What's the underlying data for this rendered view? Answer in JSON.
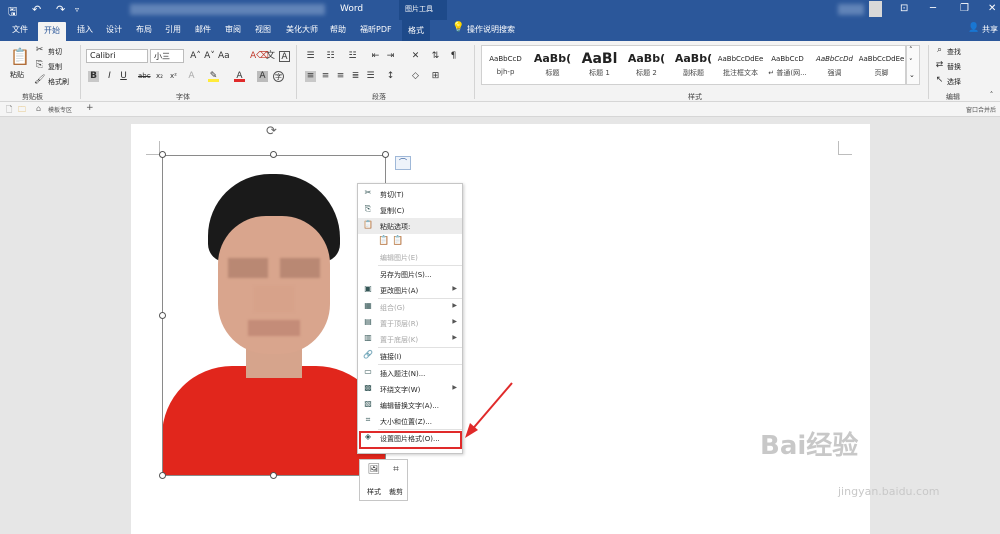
{
  "window": {
    "title": "Word",
    "context_tab_group": "图片工具"
  },
  "tabs": [
    "文件",
    "开始",
    "插入",
    "设计",
    "布局",
    "引用",
    "邮件",
    "审阅",
    "视图",
    "美化大师",
    "帮助",
    "福昕PDF",
    "格式"
  ],
  "active_tab": "开始",
  "tell_me": "操作说明搜索",
  "share_label": "共享",
  "clipboard": {
    "paste": "粘贴",
    "cut": "剪切",
    "copy": "复制",
    "format_painter": "格式刷",
    "group": "剪贴板"
  },
  "font": {
    "name": "Calibri",
    "size": "小三",
    "group": "字体",
    "bold": "B",
    "italic": "I",
    "underline": "U",
    "strike": "abc",
    "sub": "x₂",
    "sup": "x²"
  },
  "paragraph": {
    "group": "段落"
  },
  "styles": {
    "group": "样式",
    "items": [
      {
        "preview": "AaBbCcD",
        "name": "bjh-p"
      },
      {
        "preview": "AaBb(",
        "name": "标题"
      },
      {
        "preview": "AaBl",
        "name": "标题 1"
      },
      {
        "preview": "AaBb(",
        "name": "标题 2"
      },
      {
        "preview": "AaBb(",
        "name": "副标题"
      },
      {
        "preview": "AaBbCcDdEe",
        "name": "批注框文本"
      },
      {
        "preview": "AaBbCcD",
        "name": "↵ 普通(网..."
      },
      {
        "preview": "AaBbCcDd",
        "name": "强调"
      },
      {
        "preview": "AaBbCcDdEe",
        "name": "页脚"
      }
    ]
  },
  "editing": {
    "find": "查找",
    "replace": "替换",
    "select": "选择",
    "group": "编辑"
  },
  "docbar": {
    "tab": "模板专区",
    "right": "窗口合并后"
  },
  "context_menu": {
    "items": [
      {
        "icon": "✂",
        "label": "剪切(T)",
        "disabled": false
      },
      {
        "icon": "⎘",
        "label": "复制(C)",
        "disabled": false
      },
      {
        "icon": "📋",
        "label": "粘贴选项:",
        "disabled": false,
        "header": true
      },
      {
        "icon": "",
        "label": "编辑图片(E)",
        "disabled": true
      },
      {
        "icon": "",
        "label": "另存为图片(S)...",
        "disabled": false
      },
      {
        "icon": "▣",
        "label": "更改图片(A)",
        "disabled": false,
        "submenu": true
      },
      {
        "icon": "▦",
        "label": "组合(G)",
        "disabled": true,
        "submenu": true
      },
      {
        "icon": "▤",
        "label": "置于顶层(R)",
        "disabled": true,
        "submenu": true
      },
      {
        "icon": "▥",
        "label": "置于底层(K)",
        "disabled": true,
        "submenu": true
      },
      {
        "icon": "🔗",
        "label": "链接(I)",
        "disabled": false
      },
      {
        "icon": "▭",
        "label": "插入题注(N)...",
        "disabled": false
      },
      {
        "icon": "▩",
        "label": "环绕文字(W)",
        "disabled": false,
        "submenu": true
      },
      {
        "icon": "▧",
        "label": "编辑替换文字(A)...",
        "disabled": false
      },
      {
        "icon": "⌗",
        "label": "大小和位置(Z)...",
        "disabled": false
      },
      {
        "icon": "◈",
        "label": "设置图片格式(O)...",
        "disabled": false
      }
    ]
  },
  "mini_toolbar": {
    "style": "样式",
    "crop": "裁剪"
  },
  "watermark": {
    "brand": "Bai经验",
    "url": "jingyan.baidu.com"
  },
  "colors": {
    "ribbon": "#2b579a",
    "highlight": "#e02a2a",
    "shirt": "#e1261c"
  }
}
